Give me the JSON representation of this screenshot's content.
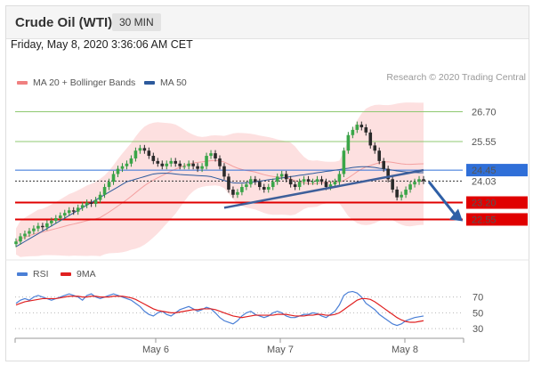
{
  "header": {
    "title": "Crude Oil (WTI)",
    "interval": "30 MIN",
    "datetime": "Friday, May 8, 2020 3:36:06 AM CET"
  },
  "legend_main": [
    {
      "label": "MA 20 + Bollinger Bands",
      "color": "#f08080"
    },
    {
      "label": "MA 50",
      "color": "#2c5a9c"
    }
  ],
  "credit": "Research © 2020 Trading Central",
  "legend_rsi": [
    {
      "label": "RSI",
      "color": "#4a7fd6"
    },
    {
      "label": "9MA",
      "color": "#e02020"
    }
  ],
  "chart_data": [
    {
      "type": "candlestick",
      "title": "Crude Oil (WTI) 30 MIN",
      "x_ticks": [
        "May 6",
        "May 7",
        "May 8"
      ],
      "ylim": [
        21.4,
        27.3
      ],
      "levels": [
        {
          "value": 26.7,
          "label": "26.70",
          "kind": "resistance",
          "color": "#8fc870"
        },
        {
          "value": 25.55,
          "label": "25.55",
          "kind": "resistance",
          "color": "#8fc870"
        },
        {
          "value": 24.45,
          "label": "24.45",
          "kind": "pivot",
          "color": "#2f6fd8"
        },
        {
          "value": 24.03,
          "label": "24.03",
          "kind": "last",
          "color": "#333333"
        },
        {
          "value": 23.2,
          "label": "23.20",
          "kind": "support",
          "color": "#e00000"
        },
        {
          "value": 22.55,
          "label": "22.55",
          "kind": "support",
          "color": "#e00000"
        }
      ],
      "closes": [
        21.7,
        21.9,
        22.0,
        22.1,
        22.2,
        22.3,
        22.25,
        22.4,
        22.5,
        22.6,
        22.7,
        22.8,
        22.9,
        22.85,
        23.0,
        23.1,
        23.2,
        23.15,
        23.3,
        23.5,
        23.8,
        24.0,
        24.3,
        24.5,
        24.6,
        24.7,
        24.9,
        25.2,
        25.3,
        25.2,
        25.0,
        24.8,
        24.7,
        24.6,
        24.7,
        24.8,
        24.7,
        24.6,
        24.6,
        24.7,
        24.6,
        24.5,
        24.6,
        25.0,
        25.1,
        24.9,
        24.6,
        24.2,
        23.7,
        23.5,
        23.6,
        23.8,
        23.9,
        24.1,
        24.0,
        23.8,
        23.7,
        23.8,
        24.0,
        24.2,
        24.3,
        24.1,
        23.9,
        23.8,
        24.0,
        24.1,
        24.0,
        24.0,
        24.1,
        24.0,
        23.8,
        23.9,
        24.0,
        24.3,
        25.2,
        25.8,
        26.0,
        26.2,
        26.1,
        25.9,
        25.4,
        25.2,
        24.8,
        24.5,
        24.1,
        23.7,
        23.4,
        23.5,
        23.7,
        23.9,
        24.0,
        24.1,
        24.03
      ],
      "ma50": [
        21.5,
        21.6,
        21.7,
        21.8,
        21.9,
        22.0,
        22.1,
        22.2,
        22.3,
        22.4,
        22.5,
        22.6,
        22.7,
        22.8,
        22.9,
        23.0,
        23.1,
        23.2,
        23.3,
        23.4,
        23.5,
        23.6,
        23.7,
        23.8,
        23.9,
        24.0,
        24.05,
        24.1,
        24.15,
        24.2,
        24.25,
        24.3,
        24.32,
        24.33,
        24.33,
        24.32,
        24.3,
        24.28,
        24.27,
        24.26,
        24.25,
        24.24,
        24.23,
        24.22,
        24.2,
        24.15,
        24.1,
        24.05,
        24.0,
        23.96,
        23.95,
        23.95,
        23.96,
        23.98,
        24.0,
        24.02,
        24.05,
        24.08,
        24.1,
        24.12,
        24.15,
        24.17,
        24.2,
        24.22,
        24.25,
        24.27,
        24.3,
        24.32,
        24.35,
        24.37,
        24.4,
        24.42,
        24.45,
        24.47,
        24.5,
        24.52,
        24.55,
        24.57,
        24.58,
        24.58,
        24.57,
        24.55,
        24.52,
        24.5,
        24.48,
        24.45,
        24.42,
        24.4,
        24.38,
        24.37,
        24.36,
        24.35,
        24.35
      ],
      "trendline_from": 23.0,
      "trendline_to": 24.45,
      "projection_to": 22.55
    },
    {
      "type": "line",
      "title": "RSI",
      "yticks": [
        70,
        50,
        30
      ],
      "ylim": [
        20,
        82
      ],
      "series": [
        {
          "name": "RSI",
          "values": [
            62,
            66,
            68,
            66,
            70,
            72,
            70,
            68,
            66,
            68,
            70,
            72,
            74,
            72,
            70,
            66,
            72,
            74,
            70,
            68,
            70,
            72,
            74,
            72,
            70,
            68,
            66,
            62,
            58,
            52,
            48,
            46,
            50,
            52,
            48,
            46,
            50,
            54,
            56,
            58,
            55,
            52,
            54,
            57,
            55,
            50,
            44,
            40,
            38,
            36,
            40,
            46,
            50,
            52,
            48,
            46,
            44,
            46,
            50,
            52,
            50,
            46,
            44,
            44,
            46,
            48,
            48,
            50,
            49,
            46,
            44,
            48,
            52,
            60,
            72,
            76,
            77,
            75,
            70,
            62,
            58,
            54,
            48,
            44,
            40,
            36,
            34,
            36,
            40,
            42,
            44,
            45,
            46
          ]
        },
        {
          "name": "9MA",
          "values": [
            60,
            62,
            64,
            65,
            66,
            67,
            68,
            68,
            68,
            68,
            69,
            70,
            71,
            71,
            71,
            70,
            70,
            71,
            71,
            70,
            70,
            70,
            71,
            71,
            71,
            70,
            69,
            67,
            64,
            61,
            58,
            55,
            53,
            52,
            51,
            50,
            50,
            51,
            52,
            53,
            54,
            54,
            55,
            55,
            55,
            54,
            52,
            50,
            48,
            46,
            45,
            44,
            45,
            46,
            47,
            47,
            47,
            47,
            47,
            48,
            48,
            48,
            47,
            46,
            46,
            46,
            47,
            47,
            48,
            48,
            47,
            47,
            48,
            50,
            54,
            58,
            62,
            66,
            68,
            68,
            67,
            64,
            60,
            56,
            52,
            48,
            44,
            41,
            39,
            38,
            38,
            39,
            40
          ]
        }
      ]
    }
  ]
}
